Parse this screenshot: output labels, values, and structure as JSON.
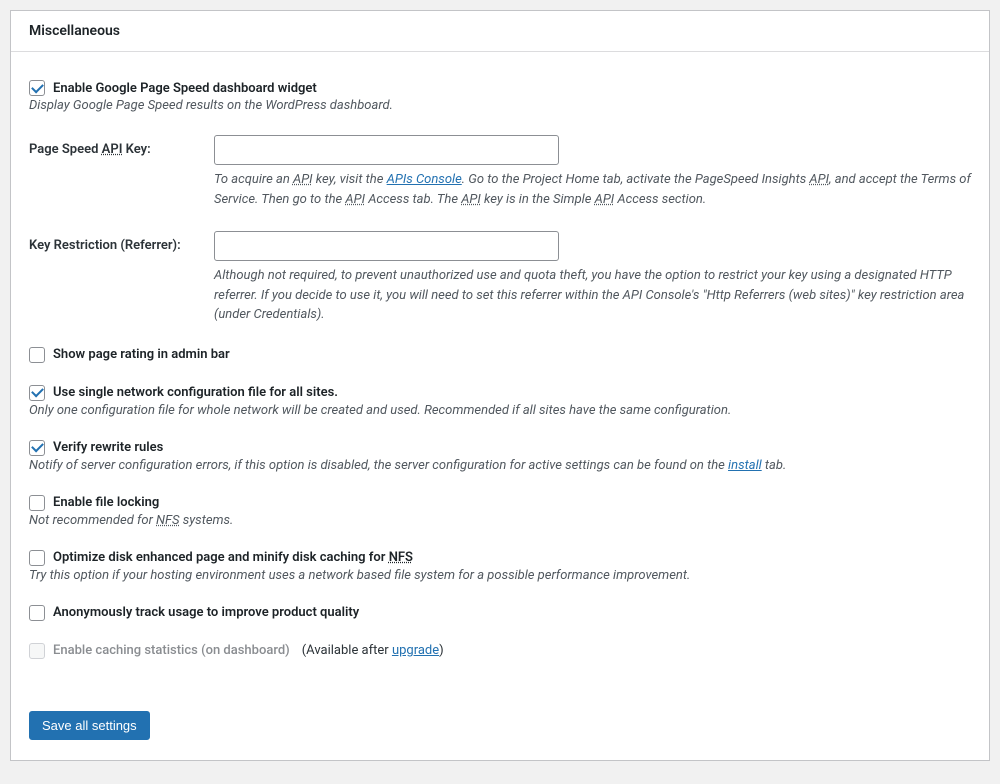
{
  "panel": {
    "title": "Miscellaneous"
  },
  "enableWidget": {
    "label": "Enable Google Page Speed dashboard widget",
    "desc": "Display Google Page Speed results on the WordPress dashboard."
  },
  "apiKey": {
    "labelPre": "Page Speed ",
    "labelAbbr": "API",
    "labelPost": " Key:",
    "help1a": "To acquire an ",
    "help1b": "API",
    "help1c": " key, visit the ",
    "help1link": "APIs Console",
    "help1d": ". Go to the Project Home tab, activate the PageSpeed Insights ",
    "help1e": "API",
    "help1f": ", and accept the Terms of Service. Then go to the ",
    "help1g": "API",
    "help1h": " Access tab. The ",
    "help1i": "API",
    "help1j": " key is in the Simple ",
    "help1k": "API",
    "help1l": " Access section."
  },
  "keyRestriction": {
    "label": "Key Restriction (Referrer):",
    "help": "Although not required, to prevent unauthorized use and quota theft, you have the option to restrict your key using a designated HTTP referrer. If you decide to use it, you will need to set this referrer within the API Console's \"Http Referrers (web sites)\" key restriction area (under Credentials)."
  },
  "showRating": {
    "label": "Show page rating in admin bar"
  },
  "singleNetwork": {
    "label": "Use single network configuration file for all sites.",
    "desc": "Only one configuration file for whole network will be created and used. Recommended if all sites have the same configuration."
  },
  "verifyRewrite": {
    "label": "Verify rewrite rules",
    "descPre": "Notify of server configuration errors, if this option is disabled, the server configuration for active settings can be found on the ",
    "descLink": "install",
    "descPost": " tab."
  },
  "fileLocking": {
    "label": "Enable file locking",
    "descPre": "Not recommended for ",
    "descAbbr": "NFS",
    "descPost": " systems."
  },
  "optimizeNfs": {
    "labelPre": "Optimize disk enhanced page and minify disk caching for ",
    "labelAbbr": "NFS",
    "desc": "Try this option if your hosting environment uses a network based file system for a possible performance improvement."
  },
  "anonTrack": {
    "label": "Anonymously track usage to improve product quality"
  },
  "cachingStats": {
    "label": "Enable caching statistics (on dashboard)",
    "afterPre": "(Available after ",
    "afterLink": "upgrade",
    "afterPost": ")"
  },
  "save": {
    "label": "Save all settings"
  }
}
